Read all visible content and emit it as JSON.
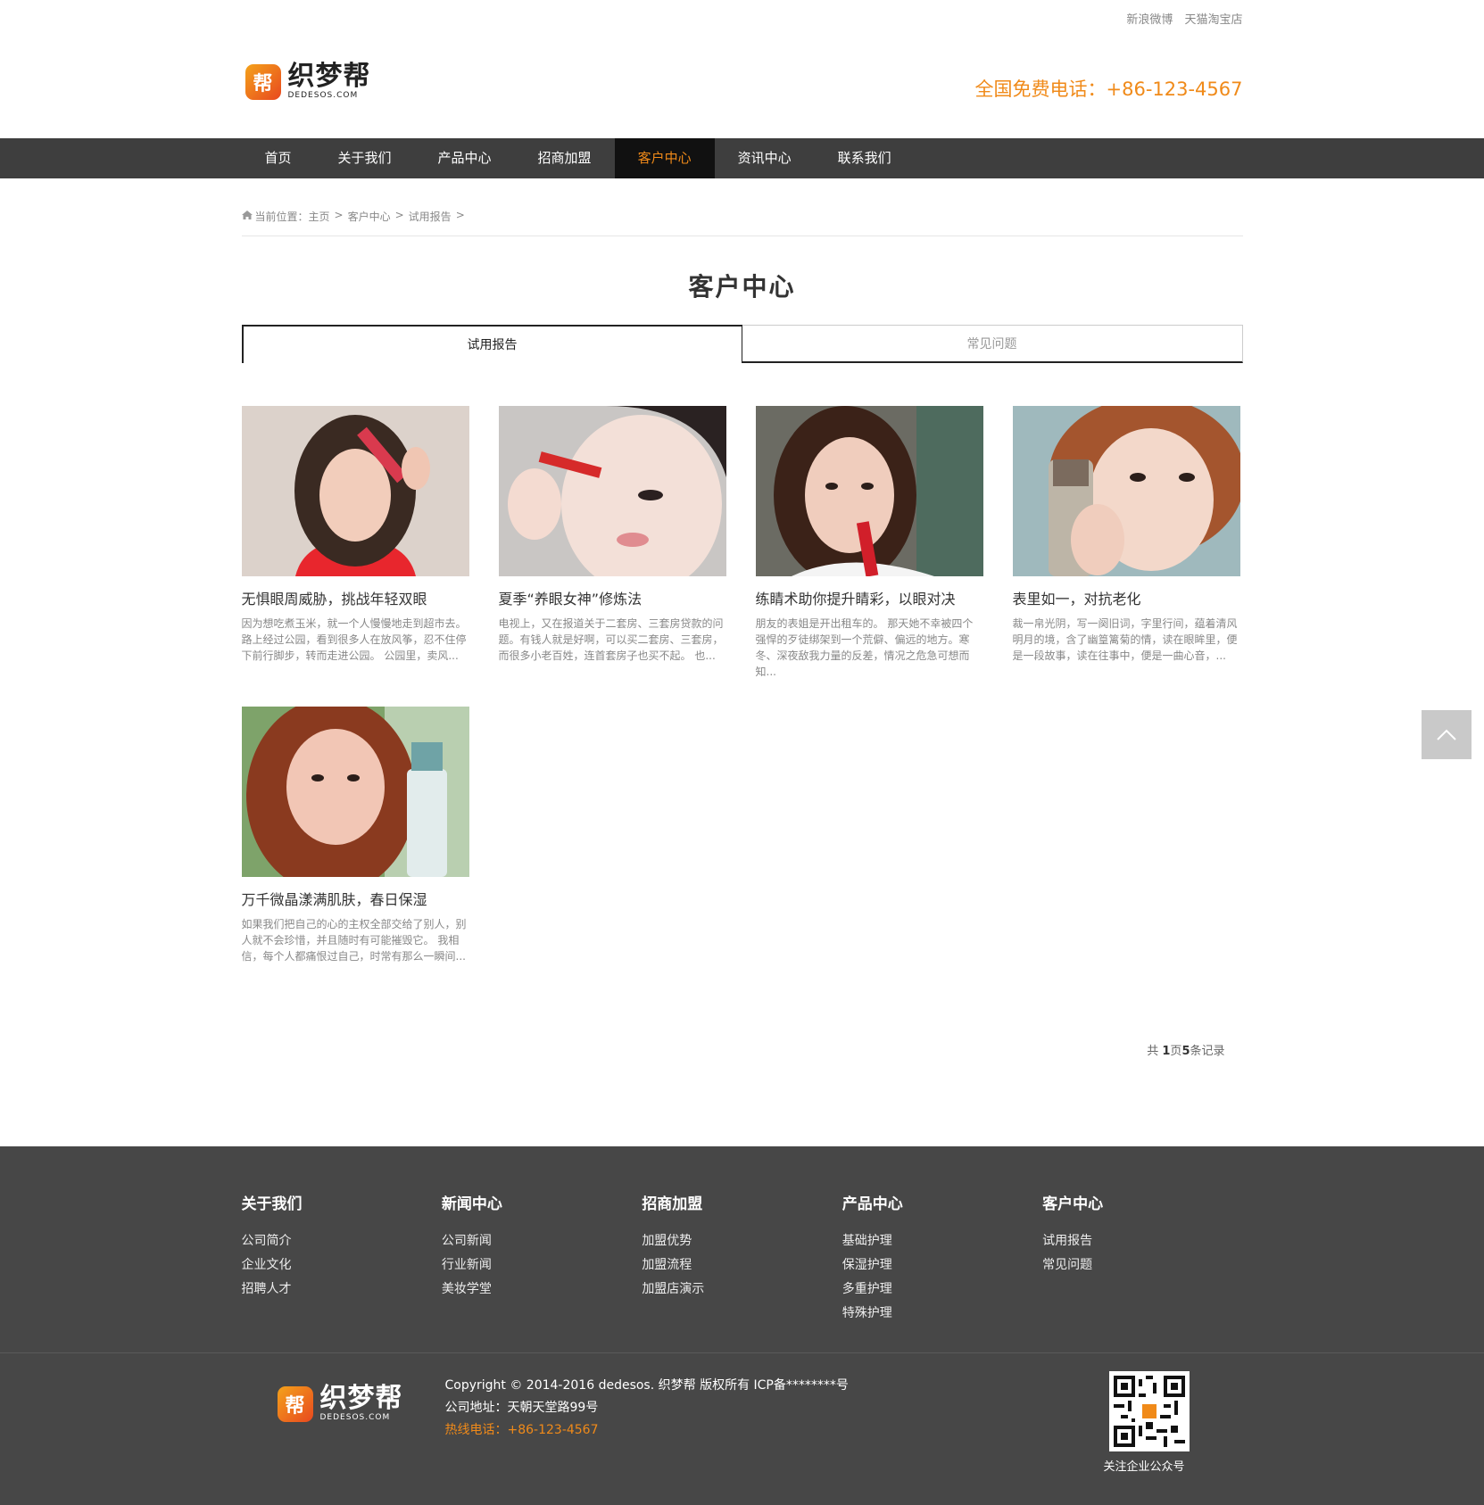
{
  "top_links": [
    "新浪微博",
    "天猫淘宝店"
  ],
  "logo": {
    "text": "织梦帮",
    "sub": "DEDESOS.COM",
    "mark": "帮"
  },
  "hotline": "全国免费电话：+86-123-4567",
  "nav": [
    "首页",
    "关于我们",
    "产品中心",
    "招商加盟",
    "客户中心",
    "资讯中心",
    "联系我们"
  ],
  "nav_active_index": 4,
  "breadcrumb": {
    "prefix": "当前位置：",
    "items": [
      "主页",
      "客户中心",
      "试用报告"
    ],
    "sep": ">"
  },
  "page_title": "客户中心",
  "tabs": [
    {
      "label": "试用报告",
      "active": true
    },
    {
      "label": "常见问题",
      "active": false
    }
  ],
  "articles": [
    {
      "title": "无惧眼周威胁，挑战年轻双眼",
      "summary": "因为想吃煮玉米，就一个人慢慢地走到超市去。路上经过公园，看到很多人在放风筝，忍不住停下前行脚步，转而走进公园。 公园里，卖风..."
    },
    {
      "title": "夏季“养眼女神”修炼法",
      "summary": "电视上，又在报道关于二套房、三套房贷款的问题。有钱人就是好啊，可以买二套房、三套房，而很多小老百姓，连首套房子也买不起。 也..."
    },
    {
      "title": "练睛术助你提升睛彩，以眼对决",
      "summary": "朋友的表姐是开出租车的。 那天她不幸被四个强悍的歹徒绑架到一个荒僻、偏远的地方。寒冬、深夜敌我力量的反差，情况之危急可想而知..."
    },
    {
      "title": "表里如一，对抗老化",
      "summary": "裁一帛光阴，写一阕旧词，字里行间，蕴着清风明月的境，含了幽篁篱菊的情，读在眼眸里，便是一段故事，读在往事中，便是一曲心音，..."
    },
    {
      "title": "万千微晶漾满肌肤，春日保湿",
      "summary": "如果我们把自己的心的主权全部交给了别人，别人就不会珍惜，并且随时有可能摧毁它。 我相信，每个人都痛恨过自己，时常有那么一瞬间..."
    }
  ],
  "pager": {
    "prefix": "共 ",
    "pages": "1",
    "mid": "页",
    "records": "5",
    "suffix": "条记录"
  },
  "footer": {
    "columns": [
      {
        "title": "关于我们",
        "items": [
          "公司简介",
          "企业文化",
          "招聘人才"
        ]
      },
      {
        "title": "新闻中心",
        "items": [
          "公司新闻",
          "行业新闻",
          "美妆学堂"
        ]
      },
      {
        "title": "招商加盟",
        "items": [
          "加盟优势",
          "加盟流程",
          "加盟店演示"
        ]
      },
      {
        "title": "产品中心",
        "items": [
          "基础护理",
          "保湿护理",
          "多重护理",
          "特殊护理"
        ]
      },
      {
        "title": "客户中心",
        "items": [
          "试用报告",
          "常见问题"
        ]
      }
    ],
    "copyright": "Copyright © 2014-2016 dedesos. 织梦帮 版权所有 ICP备********号",
    "address": "公司地址：天朝天堂路99号",
    "hotline": "热线电话：+86-123-4567",
    "qr_label": "关注企业公众号"
  },
  "colors": {
    "accent": "#f08a19",
    "nav_bg": "#3e3e3e",
    "footer_bg": "#474747"
  },
  "icons": {
    "home": "home-icon",
    "backtop": "chevron-up-icon",
    "qr": "qr-code-icon"
  }
}
